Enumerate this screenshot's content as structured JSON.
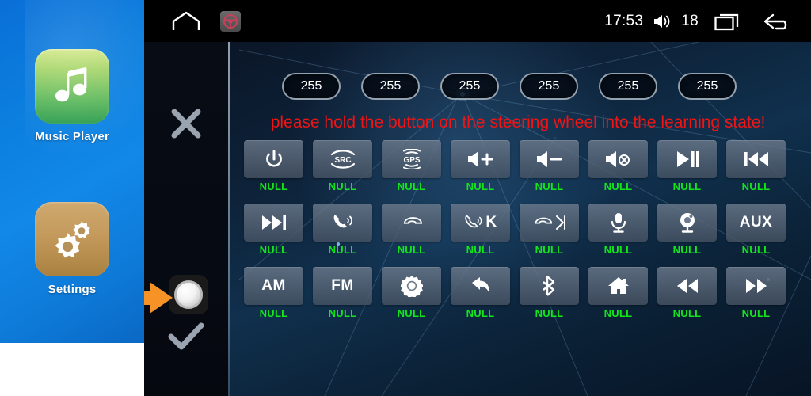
{
  "sidebar": {
    "apps": [
      {
        "label": "Music Player",
        "icon": "music-note-icon"
      },
      {
        "label": "Settings",
        "icon": "gears-icon"
      }
    ]
  },
  "statusbar": {
    "home_icon": "home-outline-icon",
    "app_icon": "steering-wheel-icon",
    "clock": "17:53",
    "volume_icon": "volume-icon",
    "volume_level": "18",
    "recents_icon": "recents-icon",
    "back_icon": "back-arrow-icon"
  },
  "actions": {
    "close_icon": "close-x-icon",
    "knob_icon": "rotary-knob-icon",
    "confirm_icon": "checkmark-icon",
    "pointer_icon": "orange-arrow-icon"
  },
  "pills": [
    {
      "value": "255"
    },
    {
      "value": "255"
    },
    {
      "value": "255"
    },
    {
      "value": "255"
    },
    {
      "value": "255"
    },
    {
      "value": "255"
    }
  ],
  "message": "please hold the button on the steering wheel into the learning state!",
  "colors": {
    "warning_text": "#f01414",
    "status_null": "#12e61b",
    "sidebar_blue": "#0b7ede",
    "pointer_orange": "#f79226"
  },
  "grid": {
    "rows": [
      [
        {
          "icon": "power-icon",
          "text": "",
          "status": "NULL"
        },
        {
          "icon": "src-icon",
          "text": "SRC",
          "status": "NULL"
        },
        {
          "icon": "gps-icon",
          "text": "GPS",
          "status": "NULL"
        },
        {
          "icon": "volume-up-icon",
          "text": "",
          "status": "NULL"
        },
        {
          "icon": "volume-down-icon",
          "text": "",
          "status": "NULL"
        },
        {
          "icon": "mute-icon",
          "text": "",
          "status": "NULL"
        },
        {
          "icon": "play-pause-icon",
          "text": "",
          "status": "NULL"
        },
        {
          "icon": "previous-track-icon",
          "text": "",
          "status": "NULL"
        }
      ],
      [
        {
          "icon": "next-track-icon",
          "text": "",
          "status": "NULL"
        },
        {
          "icon": "call-answer-icon",
          "text": "",
          "status": "NULL"
        },
        {
          "icon": "call-end-icon",
          "text": "",
          "status": "NULL"
        },
        {
          "icon": "call-answer-k-icon",
          "text": "K",
          "status": "NULL"
        },
        {
          "icon": "call-end-next-icon",
          "text": "",
          "status": "NULL"
        },
        {
          "icon": "microphone-icon",
          "text": "",
          "status": "NULL"
        },
        {
          "icon": "camera-icon",
          "text": "",
          "status": "NULL"
        },
        {
          "icon": "aux-icon",
          "text": "AUX",
          "status": "NULL"
        }
      ],
      [
        {
          "icon": "am-icon",
          "text": "AM",
          "status": "NULL"
        },
        {
          "icon": "fm-icon",
          "text": "FM",
          "status": "NULL"
        },
        {
          "icon": "brightness-icon",
          "text": "",
          "status": "NULL"
        },
        {
          "icon": "back-icon",
          "text": "",
          "status": "NULL"
        },
        {
          "icon": "bluetooth-icon",
          "text": "",
          "status": "NULL"
        },
        {
          "icon": "home-icon",
          "text": "",
          "status": "NULL"
        },
        {
          "icon": "rewind-icon",
          "text": "",
          "status": "NULL"
        },
        {
          "icon": "fast-forward-icon",
          "text": "",
          "status": "NULL"
        }
      ]
    ]
  }
}
